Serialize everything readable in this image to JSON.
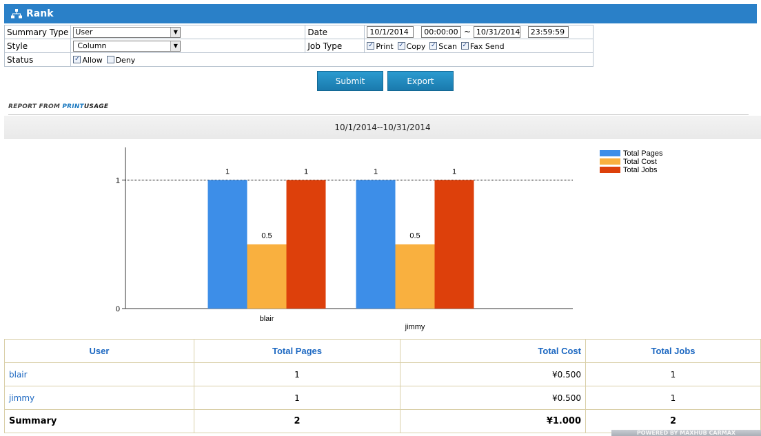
{
  "window": {
    "title": "Rank"
  },
  "filters": {
    "summary_type_label": "Summary Type",
    "summary_type_value": "User",
    "style_label": "Style",
    "style_value": "Column",
    "status_label": "Status",
    "status_allow": "Allow",
    "status_deny": "Deny",
    "date_label": "Date",
    "date_from": "10/1/2014",
    "time_from": "00:00:00",
    "range_sep": "~",
    "date_to": "10/31/2014",
    "time_to": "23:59:59",
    "job_type_label": "Job Type",
    "job_print": "Print",
    "job_copy": "Copy",
    "job_scan": "Scan",
    "job_fax": "Fax Send"
  },
  "buttons": {
    "submit": "Submit",
    "export": "Export"
  },
  "report_from": {
    "prefix": "REPORT FROM ",
    "brand_a": "PRINT",
    "brand_b": "USAGE"
  },
  "date_range": "10/1/2014--10/31/2014",
  "chart_data": {
    "type": "bar",
    "categories": [
      "blair",
      "jimmy"
    ],
    "series": [
      {
        "name": "Total Pages",
        "values": [
          1,
          1
        ],
        "color": "#3d8ee8"
      },
      {
        "name": "Total Cost",
        "values": [
          0.5,
          0.5
        ],
        "color": "#f9b03f"
      },
      {
        "name": "Total Jobs",
        "values": [
          1,
          1
        ],
        "color": "#dd400b"
      }
    ],
    "ylim": [
      0,
      1.05
    ],
    "yticks": [
      0,
      1
    ],
    "legend": "top-right",
    "title": "",
    "xlabel": "",
    "ylabel": ""
  },
  "table": {
    "headers": [
      "User",
      "Total Pages",
      "Total Cost",
      "Total Jobs"
    ],
    "rows": [
      [
        "blair",
        "1",
        "¥0.500",
        "1"
      ],
      [
        "jimmy",
        "1",
        "¥0.500",
        "1"
      ]
    ],
    "summary": [
      "Summary",
      "2",
      "¥1.000",
      "2"
    ]
  },
  "footer": {
    "powered": "POWERED BY MAXHUB  CARMAX"
  }
}
